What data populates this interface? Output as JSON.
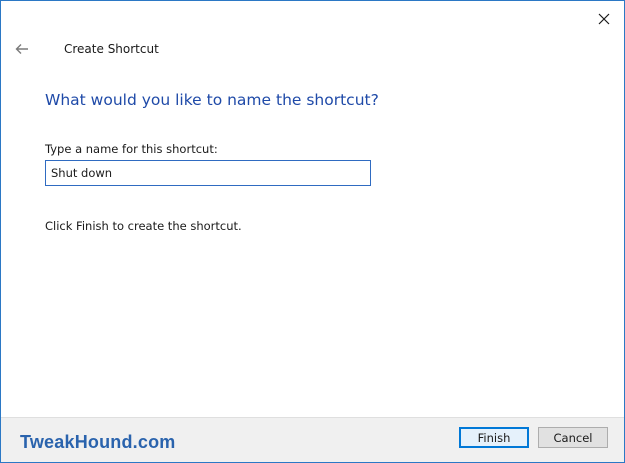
{
  "window": {
    "title": "Create Shortcut"
  },
  "wizard": {
    "heading": "What would you like to name the shortcut?",
    "field_label": "Type a name for this shortcut:",
    "name_value": "Shut down",
    "hint": "Click Finish to create the shortcut."
  },
  "footer": {
    "watermark": "TweakHound.com",
    "finish_label": "Finish",
    "cancel_label": "Cancel"
  },
  "icons": {
    "close": "close-icon",
    "back": "back-arrow-icon"
  },
  "colors": {
    "accent": "#1f4aa8",
    "button_focus": "#0078d7",
    "watermark": "#2a63ad",
    "footer_bg": "#f0f0f0"
  }
}
